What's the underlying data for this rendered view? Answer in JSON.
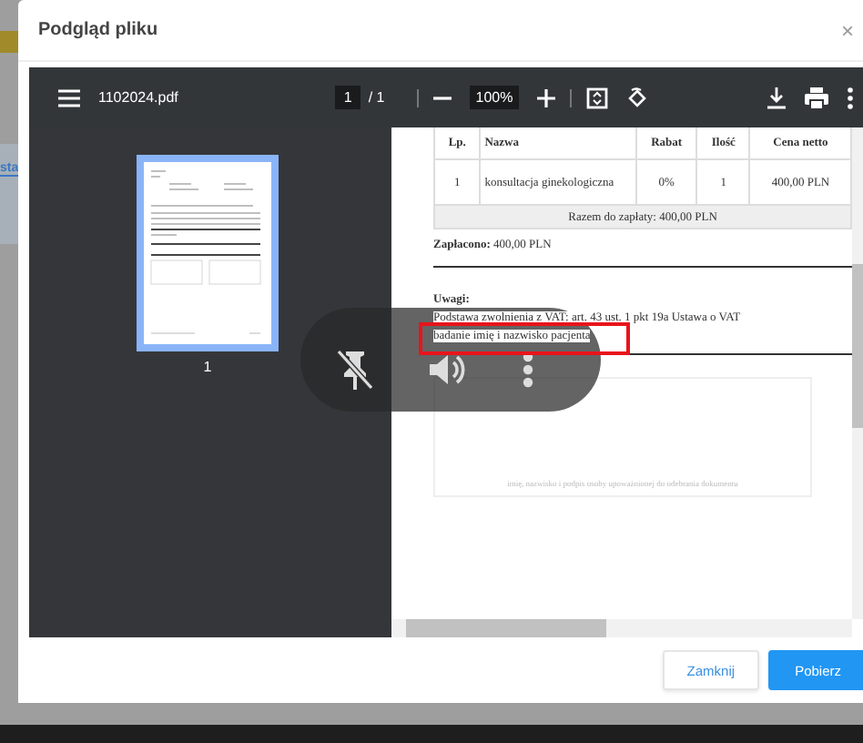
{
  "background_page": {
    "tab_fragment": "sta"
  },
  "dialog": {
    "title": "Podgląd pliku",
    "close": "×"
  },
  "viewer": {
    "toolbar": {
      "file_name": "1102024.pdf",
      "page": "1",
      "page_count": "/ 1",
      "zoom": "100%"
    },
    "thumbnails": [
      {
        "label": "1",
        "selected": true
      }
    ],
    "invoice": {
      "columns": [
        "Lp.",
        "Nazwa",
        "Rabat",
        "Ilość",
        "Cena netto"
      ],
      "rows": [
        [
          "1",
          "konsultacja ginekologiczna",
          "0%",
          "1",
          "400,00 PLN"
        ]
      ],
      "total": "Razem do zapłaty: 400,00 PLN",
      "paid": "**Zapłacono:** 400,00 PLN",
      "notes_title": "Uwagi:",
      "notes": [
        "Podstawa zwolnienia z VAT: art. 43 ust. 1 pkt 19a Ustawa o VAT",
        "badanie imię i nazwisko pacjenta"
      ],
      "signature_caption": "imię, nazwisko i podpis osoby upoważnionej do odebrania dokumentu"
    }
  },
  "buttons": [
    {
      "label": "Zamknij",
      "kind": "secondary"
    },
    {
      "label": "Pobierz",
      "kind": "primary"
    }
  ]
}
